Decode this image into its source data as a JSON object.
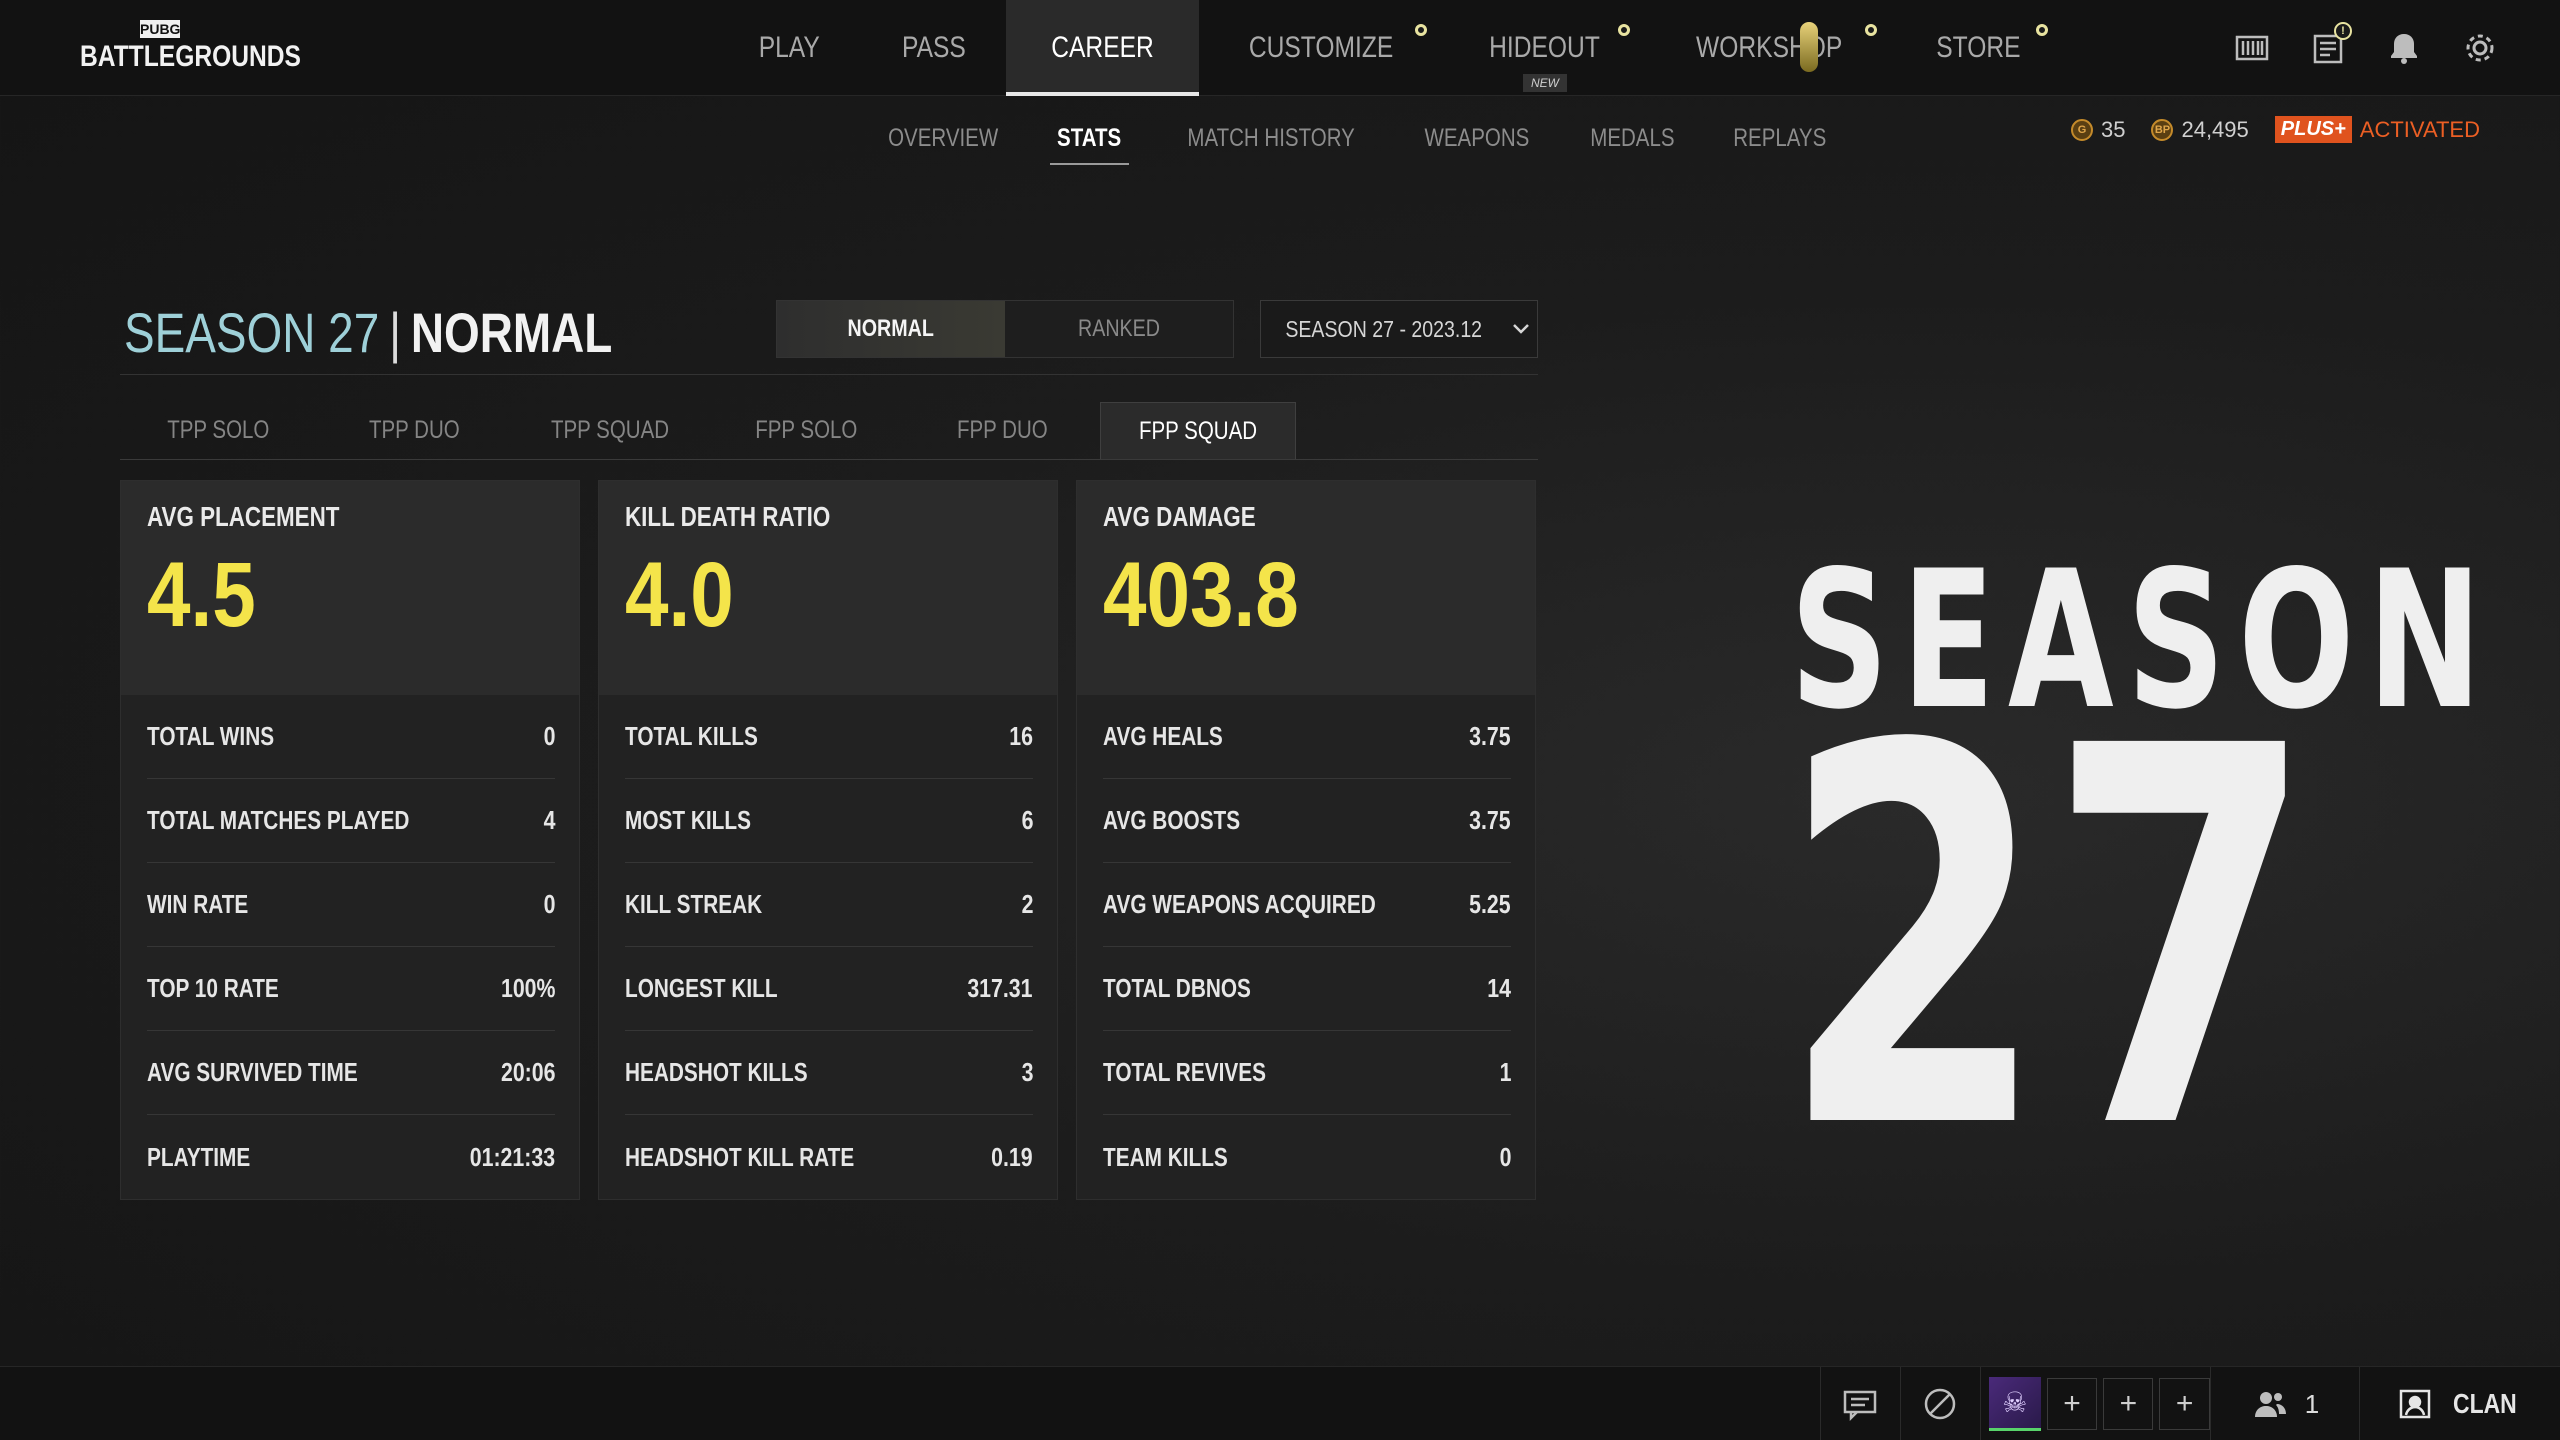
{
  "logo": {
    "small": "PUBG",
    "big": "BATTLEGROUNDS"
  },
  "mainnav": [
    {
      "label": "PLAY"
    },
    {
      "label": "PASS"
    },
    {
      "label": "CAREER"
    },
    {
      "label": "CUSTOMIZE"
    },
    {
      "label": "HIDEOUT",
      "tag": "NEW"
    },
    {
      "label": "WORKSHOP"
    },
    {
      "label": "STORE"
    }
  ],
  "subnav": [
    "OVERVIEW",
    "STATS",
    "MATCH HISTORY",
    "WEAPONS",
    "MEDALS",
    "REPLAYS"
  ],
  "currency": {
    "g_coin": "35",
    "bp_icon": "BP",
    "bp": "24,495",
    "plus": "PLUS+",
    "plus_status": "ACTIVATED",
    "g_icon": "G"
  },
  "title": {
    "season": "SEASON 27",
    "divider": "|",
    "mode": "NORMAL"
  },
  "mode_switch": [
    "NORMAL",
    "RANKED"
  ],
  "season_select": "SEASON 27 - 2023.12",
  "game_tabs": [
    "TPP SOLO",
    "TPP DUO",
    "TPP SQUAD",
    "FPP SOLO",
    "FPP DUO",
    "FPP SQUAD"
  ],
  "cards": [
    {
      "title": "AVG PLACEMENT",
      "value": "4.5",
      "rows": [
        {
          "k": "TOTAL WINS",
          "v": "0"
        },
        {
          "k": "TOTAL MATCHES PLAYED",
          "v": "4"
        },
        {
          "k": "WIN RATE",
          "v": "0"
        },
        {
          "k": "TOP 10 RATE",
          "v": "100%"
        },
        {
          "k": "AVG SURVIVED TIME",
          "v": "20:06"
        },
        {
          "k": "PLAYTIME",
          "v": "01:21:33"
        }
      ]
    },
    {
      "title": "KILL DEATH RATIO",
      "value": "4.0",
      "rows": [
        {
          "k": "TOTAL KILLS",
          "v": "16"
        },
        {
          "k": "MOST KILLS",
          "v": "6"
        },
        {
          "k": "KILL STREAK",
          "v": "2"
        },
        {
          "k": "LONGEST KILL",
          "v": "317.31"
        },
        {
          "k": "HEADSHOT KILLS",
          "v": "3"
        },
        {
          "k": "HEADSHOT KILL RATE",
          "v": "0.19"
        }
      ]
    },
    {
      "title": "AVG DAMAGE",
      "value": "403.8",
      "rows": [
        {
          "k": "AVG HEALS",
          "v": "3.75"
        },
        {
          "k": "AVG BOOSTS",
          "v": "3.75"
        },
        {
          "k": "AVG WEAPONS ACQUIRED",
          "v": "5.25"
        },
        {
          "k": "TOTAL DBNOS",
          "v": "14"
        },
        {
          "k": "TOTAL REVIVES",
          "v": "1"
        },
        {
          "k": "TEAM KILLS",
          "v": "0"
        }
      ]
    }
  ],
  "art": {
    "word": "SEASON",
    "number": "27"
  },
  "bottombar": {
    "slot_plus": "+",
    "friends_count": "1",
    "clan_label": "CLAN"
  },
  "alert_badge": "!",
  "colors": {
    "accent_yellow": "#f4e44a",
    "season_blue": "#9ed0d8",
    "plus_orange": "#e0531e"
  }
}
